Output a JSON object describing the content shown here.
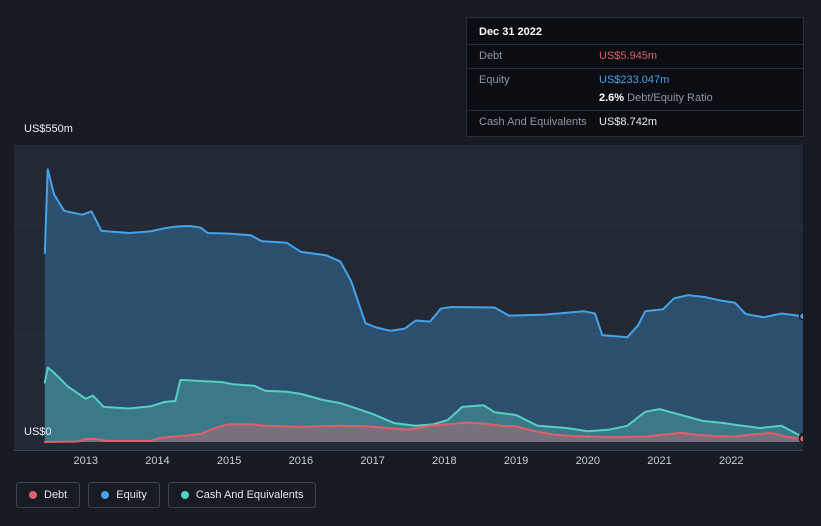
{
  "tooltip": {
    "date": "Dec 31 2022",
    "debt_label": "Debt",
    "debt_value": "US$5.945m",
    "equity_label": "Equity",
    "equity_value": "US$233.047m",
    "ratio_value": "2.6%",
    "ratio_label": "Debt/Equity Ratio",
    "cash_label": "Cash And Equivalents",
    "cash_value": "US$8.742m"
  },
  "axis": {
    "y_top": "US$550m",
    "y_bottom": "US$0"
  },
  "legend": {
    "items": [
      {
        "label": "Debt",
        "color": "#e0606a"
      },
      {
        "label": "Equity",
        "color": "#45a2e8"
      },
      {
        "label": "Cash And Equivalents",
        "color": "#57cec2"
      }
    ]
  },
  "colors": {
    "background": "#151a23",
    "plot_background": "#222834",
    "debt": "#e0606a",
    "equity": "#45a2e8",
    "cash": "#57cec2"
  },
  "chart_data": {
    "type": "area",
    "x_range": [
      2012,
      2023
    ],
    "ylim": [
      0,
      550
    ],
    "y_axis_tick_labels": [
      "US$0",
      "US$550m"
    ],
    "y_gridlines": [
      200,
      400,
      550
    ],
    "x_ticks": [
      "2013",
      "2014",
      "2015",
      "2016",
      "2017",
      "2018",
      "2019",
      "2020",
      "2021",
      "2022"
    ],
    "legend_position": "bottom-left",
    "series": [
      {
        "name": "Equity",
        "color": "#45a2e8",
        "fill_opacity": 0.32,
        "final_value_m": 233.047,
        "points": [
          [
            2012.43,
            350
          ],
          [
            2012.47,
            505
          ],
          [
            2012.56,
            458
          ],
          [
            2012.7,
            428
          ],
          [
            2012.95,
            421
          ],
          [
            2013.08,
            427
          ],
          [
            2013.22,
            391
          ],
          [
            2013.6,
            387
          ],
          [
            2013.9,
            390
          ],
          [
            2014.1,
            396
          ],
          [
            2014.27,
            399
          ],
          [
            2014.45,
            400
          ],
          [
            2014.6,
            397
          ],
          [
            2014.7,
            387
          ],
          [
            2015.0,
            386
          ],
          [
            2015.3,
            383
          ],
          [
            2015.45,
            372
          ],
          [
            2015.8,
            369
          ],
          [
            2016.0,
            352
          ],
          [
            2016.35,
            346
          ],
          [
            2016.55,
            334
          ],
          [
            2016.7,
            298
          ],
          [
            2016.9,
            220
          ],
          [
            2017.05,
            212
          ],
          [
            2017.25,
            206
          ],
          [
            2017.45,
            210
          ],
          [
            2017.6,
            225
          ],
          [
            2017.8,
            223
          ],
          [
            2017.95,
            247
          ],
          [
            2018.1,
            250
          ],
          [
            2018.7,
            249
          ],
          [
            2018.9,
            234
          ],
          [
            2019.4,
            236
          ],
          [
            2019.95,
            242
          ],
          [
            2020.1,
            238
          ],
          [
            2020.2,
            198
          ],
          [
            2020.55,
            194
          ],
          [
            2020.7,
            216
          ],
          [
            2020.8,
            242
          ],
          [
            2021.05,
            246
          ],
          [
            2021.2,
            266
          ],
          [
            2021.4,
            272
          ],
          [
            2021.65,
            268
          ],
          [
            2021.85,
            262
          ],
          [
            2022.05,
            258
          ],
          [
            2022.2,
            237
          ],
          [
            2022.45,
            231
          ],
          [
            2022.7,
            238
          ],
          [
            2023.0,
            233.047
          ]
        ]
      },
      {
        "name": "Cash And Equivalents",
        "color": "#57cec2",
        "fill_opacity": 0.33,
        "final_value_m": 8.742,
        "points": [
          [
            2012.43,
            110
          ],
          [
            2012.47,
            138
          ],
          [
            2012.56,
            128
          ],
          [
            2012.75,
            103
          ],
          [
            2013.0,
            80
          ],
          [
            2013.1,
            86
          ],
          [
            2013.25,
            65
          ],
          [
            2013.6,
            62
          ],
          [
            2013.9,
            66
          ],
          [
            2014.1,
            74
          ],
          [
            2014.25,
            76
          ],
          [
            2014.32,
            115
          ],
          [
            2014.6,
            113
          ],
          [
            2014.9,
            111
          ],
          [
            2015.05,
            107
          ],
          [
            2015.35,
            104
          ],
          [
            2015.5,
            95
          ],
          [
            2015.8,
            93
          ],
          [
            2016.0,
            89
          ],
          [
            2016.3,
            78
          ],
          [
            2016.55,
            72
          ],
          [
            2016.8,
            61
          ],
          [
            2017.0,
            52
          ],
          [
            2017.3,
            35
          ],
          [
            2017.6,
            30
          ],
          [
            2017.85,
            33
          ],
          [
            2018.05,
            41
          ],
          [
            2018.25,
            65
          ],
          [
            2018.55,
            68
          ],
          [
            2018.7,
            55
          ],
          [
            2019.0,
            50
          ],
          [
            2019.3,
            30
          ],
          [
            2019.7,
            26
          ],
          [
            2020.0,
            20
          ],
          [
            2020.3,
            23
          ],
          [
            2020.55,
            30
          ],
          [
            2020.8,
            56
          ],
          [
            2021.0,
            61
          ],
          [
            2021.3,
            50
          ],
          [
            2021.6,
            39
          ],
          [
            2021.9,
            35
          ],
          [
            2022.1,
            31
          ],
          [
            2022.4,
            26
          ],
          [
            2022.7,
            30
          ],
          [
            2023.0,
            8.742
          ]
        ]
      },
      {
        "name": "Debt",
        "color": "#e0606a",
        "fill_opacity": 0.38,
        "final_value_m": 5.945,
        "points": [
          [
            2012.43,
            0
          ],
          [
            2012.9,
            1
          ],
          [
            2013.0,
            6
          ],
          [
            2013.18,
            5
          ],
          [
            2013.3,
            2
          ],
          [
            2013.9,
            2
          ],
          [
            2014.05,
            8
          ],
          [
            2014.4,
            12
          ],
          [
            2014.6,
            15
          ],
          [
            2014.8,
            26
          ],
          [
            2015.0,
            33
          ],
          [
            2015.3,
            33
          ],
          [
            2015.5,
            30
          ],
          [
            2016.0,
            28
          ],
          [
            2016.5,
            30
          ],
          [
            2016.9,
            29
          ],
          [
            2017.2,
            26
          ],
          [
            2017.5,
            23
          ],
          [
            2017.8,
            30
          ],
          [
            2018.05,
            33
          ],
          [
            2018.3,
            36
          ],
          [
            2018.55,
            34
          ],
          [
            2018.8,
            30
          ],
          [
            2019.0,
            29
          ],
          [
            2019.2,
            22
          ],
          [
            2019.5,
            14
          ],
          [
            2019.8,
            11
          ],
          [
            2020.3,
            9
          ],
          [
            2020.8,
            10
          ],
          [
            2021.0,
            13
          ],
          [
            2021.3,
            17
          ],
          [
            2021.55,
            13
          ],
          [
            2021.8,
            11
          ],
          [
            2022.05,
            10
          ],
          [
            2022.3,
            14
          ],
          [
            2022.55,
            17
          ],
          [
            2022.8,
            9
          ],
          [
            2023.0,
            5.945
          ]
        ]
      }
    ]
  }
}
